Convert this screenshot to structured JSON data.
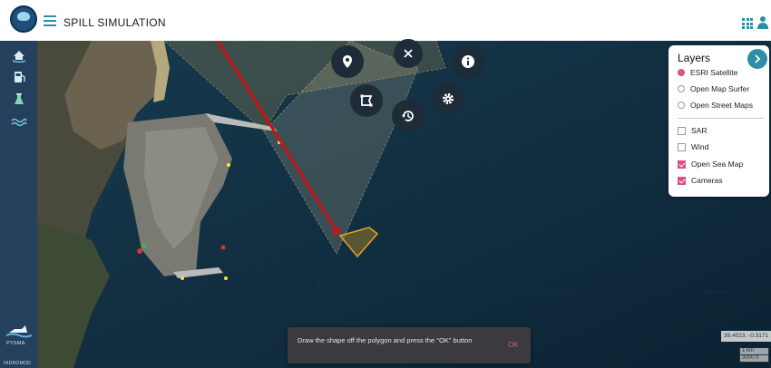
{
  "app": {
    "title": "SPILL SIMULATION"
  },
  "sidebar": {
    "items": [
      {
        "icon": "ship-home-icon"
      },
      {
        "icon": "fuel-icon"
      },
      {
        "icon": "flask-icon"
      },
      {
        "icon": "waves-icon"
      }
    ],
    "logo_text": "PYSMA",
    "brand_text": "HIDROMOD"
  },
  "toolbar": {
    "buttons": [
      "location-pin-icon",
      "close-icon",
      "info-icon",
      "polygon-icon",
      "history-icon",
      "gear-icon"
    ]
  },
  "layers": {
    "title": "Layers",
    "base_layers": [
      {
        "label": "ESRI Satellite",
        "selected": true
      },
      {
        "label": "Open Map Surfer",
        "selected": false
      },
      {
        "label": "Open Street Maps",
        "selected": false
      }
    ],
    "overlays": [
      {
        "label": "SAR",
        "checked": false
      },
      {
        "label": "Wind",
        "checked": false
      },
      {
        "label": "Open Sea Map",
        "checked": true
      },
      {
        "label": "Cameras",
        "checked": true
      }
    ]
  },
  "toast": {
    "message": "Draw the shape off the polygon and press the \"OK\" button",
    "action": "OK"
  },
  "map": {
    "coords": "39.4023, -0.3171",
    "scale_top": "1 km",
    "scale_bottom": "3000 ft"
  },
  "colors": {
    "accent": "#2e8ea6",
    "check": "#d94f86",
    "annotation": "#cc1111",
    "polygon": "#e0a020"
  }
}
